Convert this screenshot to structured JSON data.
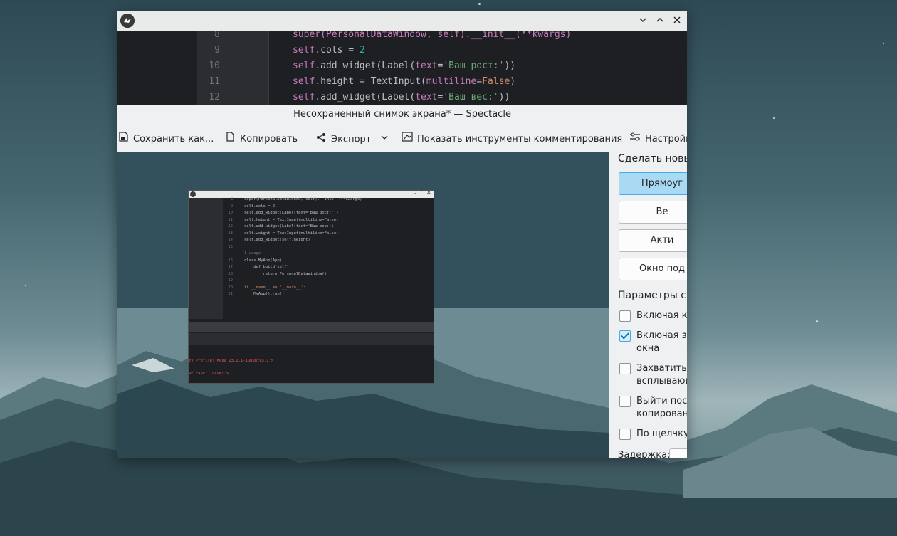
{
  "kivy_window": {
    "logo": "kivy-logo",
    "controls": {
      "minimize": "⌄",
      "maximize": "⌃",
      "close": "✕"
    },
    "code_lines": [
      {
        "num": "8",
        "parts": [
          [
            "self",
            "super(PersonalDataWindow, self).__init__(**kwargs)"
          ]
        ]
      },
      {
        "num": "9",
        "parts": [
          [
            "self",
            "self"
          ],
          [
            "plain",
            ".cols = "
          ],
          [
            "num",
            "2"
          ]
        ]
      },
      {
        "num": "10",
        "parts": [
          [
            "self",
            "self"
          ],
          [
            "plain",
            ".add_widget(Label("
          ],
          [
            "param",
            "text"
          ],
          [
            "plain",
            "="
          ],
          [
            "str",
            "'Ваш рост:'"
          ],
          [
            "plain",
            "))"
          ]
        ]
      },
      {
        "num": "11",
        "parts": [
          [
            "self",
            "self"
          ],
          [
            "plain",
            ".height = TextInput("
          ],
          [
            "param",
            "multiline"
          ],
          [
            "plain",
            "="
          ],
          [
            "orange",
            "False"
          ],
          [
            "plain",
            ")"
          ]
        ]
      },
      {
        "num": "12",
        "parts": [
          [
            "self",
            "self"
          ],
          [
            "plain",
            ".add_widget(Label("
          ],
          [
            "param",
            "text"
          ],
          [
            "plain",
            "="
          ],
          [
            "str",
            "'Ваш вес:'"
          ],
          [
            "plain",
            "))"
          ]
        ]
      }
    ]
  },
  "spectacle": {
    "window_title": "Несохраненный снимок экрана* — Spectacle",
    "toolbar": {
      "save_as": "Сохранить как...",
      "copy": "Копировать",
      "export": "Экспорт",
      "annotate": "Показать инструменты комментирования",
      "settings": "Настройк"
    },
    "side_panel": {
      "take_new_heading": "Сделать новы",
      "buttons": [
        "Прямоуг",
        "Ве",
        "Акти",
        "Окно под"
      ],
      "params_heading": "Параметры сн",
      "options": [
        {
          "label": "Включая ку",
          "label2": "",
          "checked": false
        },
        {
          "label": "Включая за",
          "label2": "окна",
          "checked": true
        },
        {
          "label": "Захватить т",
          "label2": "всплывающ",
          "checked": false
        },
        {
          "label": "Выйти посл",
          "label2": "копировани",
          "checked": false
        },
        {
          "label": "По щелчку",
          "label2": "",
          "checked": false
        }
      ],
      "delay_label": "Задержка:"
    }
  },
  "thumbnail": {
    "code": [
      {
        "num": "8",
        "text": "super(PersonalDataWindow, self).__init__(**kwargs)"
      },
      {
        "num": "9",
        "text": "self.cols = 2"
      },
      {
        "num": "10",
        "text": "self.add_widget(Label(text='Ваш рост:'))"
      },
      {
        "num": "11",
        "text": "self.height = TextInput(multiline=False)"
      },
      {
        "num": "12",
        "text": "self.add_widget(Label(text='Ваш вес:'))"
      },
      {
        "num": "13",
        "text": "self.weight = TextInput(multiline=False)"
      },
      {
        "num": "14",
        "text": "self.add_widget(self.height)"
      },
      {
        "num": "15",
        "text": ""
      },
      {
        "num": "",
        "text": "1 usage"
      },
      {
        "num": "16",
        "text": "class MyApp(App):"
      },
      {
        "num": "17",
        "text": "    def build(self):"
      },
      {
        "num": "18",
        "text": "        return PersonalDataWindow()"
      },
      {
        "num": "19",
        "text": ""
      },
      {
        "num": "20",
        "text": "if __name__ == '__main__':"
      },
      {
        "num": "21",
        "text": "    MyApp().run()"
      }
    ],
    "term_line1": "ty Profile) Mesa 23.2.1-1ubuntu3.1'>",
    "term_line2": "RELEASE;  LLVM;'>"
  }
}
